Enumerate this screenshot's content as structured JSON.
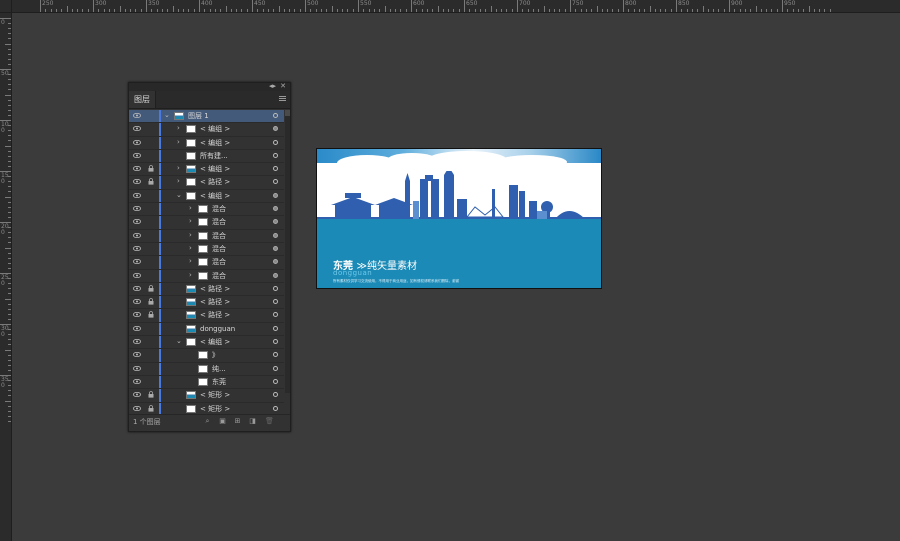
{
  "ruler": {
    "top_labels": [
      "250",
      "300",
      "350",
      "400",
      "450",
      "500",
      "550",
      "600",
      "650",
      "700",
      "750",
      "800",
      "850",
      "900",
      "950"
    ],
    "left_labels": [
      "0",
      "50",
      "100",
      "150",
      "200",
      "250",
      "300",
      "350"
    ]
  },
  "panel": {
    "tab": "图层",
    "collapse_icon": "collapse-arrows-icon",
    "close_icon": "close-icon",
    "footer_count": "1 个图层",
    "layers": [
      {
        "name": "图层 1",
        "indent": 0,
        "arrow": "down",
        "thumb": "pic",
        "lock": false,
        "target": "empty",
        "selected": true
      },
      {
        "name": "< 编组 >",
        "indent": 1,
        "arrow": "right",
        "thumb": "white",
        "lock": false,
        "target": "fill"
      },
      {
        "name": "< 编组 >",
        "indent": 1,
        "arrow": "right",
        "thumb": "white",
        "lock": false,
        "target": "empty"
      },
      {
        "name": "所有建...",
        "indent": 1,
        "arrow": "none",
        "thumb": "white",
        "lock": false,
        "target": "empty"
      },
      {
        "name": "< 编组 >",
        "indent": 1,
        "arrow": "right",
        "thumb": "pic",
        "lock": true,
        "target": "empty"
      },
      {
        "name": "< 路径 >",
        "indent": 1,
        "arrow": "right",
        "thumb": "white",
        "lock": true,
        "target": "empty"
      },
      {
        "name": "< 编组 >",
        "indent": 1,
        "arrow": "down",
        "thumb": "white",
        "lock": false,
        "target": "fill"
      },
      {
        "name": "混合",
        "indent": 2,
        "arrow": "right",
        "thumb": "white",
        "lock": false,
        "target": "fill"
      },
      {
        "name": "混合",
        "indent": 2,
        "arrow": "right",
        "thumb": "white",
        "lock": false,
        "target": "fill"
      },
      {
        "name": "混合",
        "indent": 2,
        "arrow": "right",
        "thumb": "white",
        "lock": false,
        "target": "fill"
      },
      {
        "name": "混合",
        "indent": 2,
        "arrow": "right",
        "thumb": "white",
        "lock": false,
        "target": "fill"
      },
      {
        "name": "混合",
        "indent": 2,
        "arrow": "right",
        "thumb": "white",
        "lock": false,
        "target": "fill"
      },
      {
        "name": "混合",
        "indent": 2,
        "arrow": "right",
        "thumb": "white",
        "lock": false,
        "target": "fill"
      },
      {
        "name": "< 路径 >",
        "indent": 1,
        "arrow": "none",
        "thumb": "pic",
        "lock": true,
        "target": "empty"
      },
      {
        "name": "< 路径 >",
        "indent": 1,
        "arrow": "none",
        "thumb": "pic",
        "lock": true,
        "target": "empty"
      },
      {
        "name": "< 路径 >",
        "indent": 1,
        "arrow": "none",
        "thumb": "pic",
        "lock": true,
        "target": "empty"
      },
      {
        "name": "dongguan",
        "indent": 1,
        "arrow": "none",
        "thumb": "pic",
        "lock": false,
        "target": "empty"
      },
      {
        "name": "< 编组 >",
        "indent": 1,
        "arrow": "down",
        "thumb": "white",
        "lock": false,
        "target": "empty"
      },
      {
        "name": "》",
        "indent": 2,
        "arrow": "none",
        "thumb": "white",
        "lock": false,
        "target": "empty"
      },
      {
        "name": "纯...",
        "indent": 2,
        "arrow": "none",
        "thumb": "white",
        "lock": false,
        "target": "empty"
      },
      {
        "name": "东莞",
        "indent": 2,
        "arrow": "none",
        "thumb": "white",
        "lock": false,
        "target": "empty"
      },
      {
        "name": "< 矩形 >",
        "indent": 1,
        "arrow": "none",
        "thumb": "pic",
        "lock": true,
        "target": "empty"
      },
      {
        "name": "< 矩形 >",
        "indent": 1,
        "arrow": "none",
        "thumb": "white",
        "lock": true,
        "target": "empty"
      }
    ],
    "footer_icons": [
      "search-layer-icon",
      "make-clipping-mask-icon",
      "new-sublayer-icon",
      "new-layer-icon",
      "delete-layer-icon"
    ]
  },
  "artwork": {
    "title_main": "东莞",
    "title_rest": "≫纯矢量素材",
    "subtitle": "dongguan",
    "footer_text": "所有素材仅供学习交流使用，不得用于商业用途，如有侵权请联系我们删除，谢谢",
    "colors": {
      "sea": "#1b8ab6",
      "skyline": "#2f5fae",
      "sky_top": "#2a8ac8"
    }
  }
}
